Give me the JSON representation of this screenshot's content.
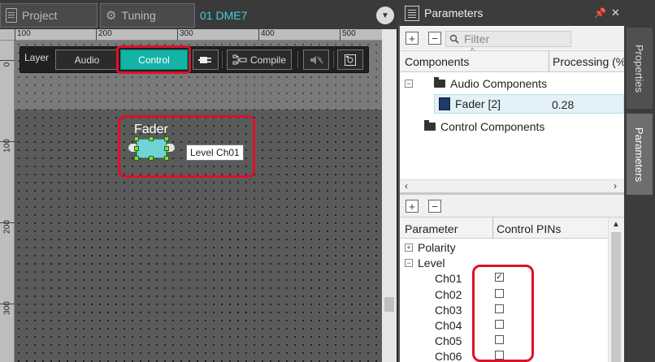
{
  "tabs": {
    "project": "Project",
    "tuning": "Tuning",
    "active": "01 DME7"
  },
  "ruler": {
    "top": [
      "100",
      "200",
      "300",
      "400",
      "500"
    ],
    "left": [
      "0",
      "100",
      "200",
      "300"
    ]
  },
  "toolbar": {
    "layer_label": "Layer",
    "audio": "Audio",
    "control": "Control",
    "compile": "Compile"
  },
  "component": {
    "title": "Fader",
    "tooltip": "Level Ch01"
  },
  "parameters_panel": {
    "title": "Parameters",
    "filter_placeholder": "Filter",
    "columns": [
      "Components",
      "Processing (%"
    ],
    "tree": {
      "audio_components": "Audio Components",
      "fader_item": "Fader [2]",
      "fader_processing": "0.28",
      "control_components": "Control Components"
    },
    "pin_columns": [
      "Parameter",
      "Control PINs"
    ],
    "groups": [
      {
        "name": "Polarity",
        "expanded": false
      },
      {
        "name": "Level",
        "expanded": true
      }
    ],
    "channels": [
      {
        "name": "Ch01",
        "checked": true
      },
      {
        "name": "Ch02",
        "checked": false
      },
      {
        "name": "Ch03",
        "checked": false
      },
      {
        "name": "Ch04",
        "checked": false
      },
      {
        "name": "Ch05",
        "checked": false
      },
      {
        "name": "Ch06",
        "checked": false
      }
    ]
  },
  "side_tabs": {
    "properties": "Properties",
    "parameters": "Parameters"
  },
  "colors": {
    "accent_teal": "#13b3a5",
    "highlight_red": "#e0102a",
    "fader_fill": "#6fd4d6",
    "tab_cyan": "#3fd0e0"
  }
}
